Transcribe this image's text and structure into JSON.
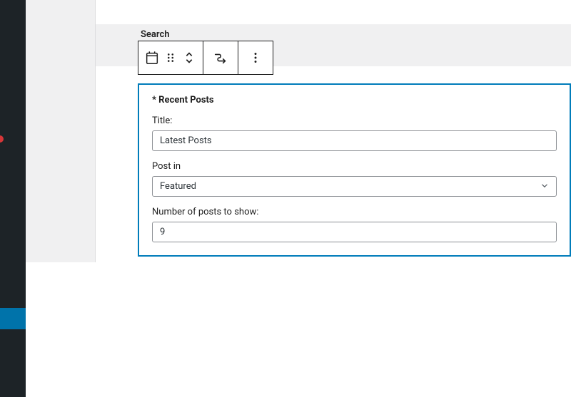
{
  "sidebar_area": {
    "search_label": "Search"
  },
  "widget": {
    "header": "* Recent Posts",
    "title_label": "Title:",
    "title_value": "Latest Posts",
    "postin_label": "Post in",
    "postin_value": "Featured",
    "numposts_label": "Number of posts to show:",
    "numposts_value": "9"
  }
}
